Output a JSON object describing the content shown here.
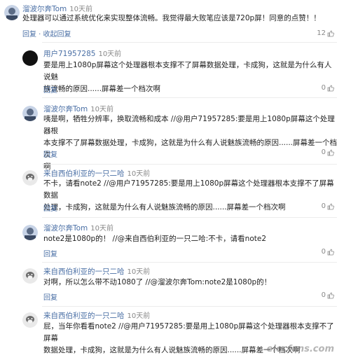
{
  "top": {
    "name": "溜波尔奔Tom",
    "time": "10天前",
    "text": "处理器可以通过系统优化来实现整体流畅。我觉得最大败笔应该是720p屏！同意的点赞！！",
    "reply": "回复",
    "collapse": "收起回复",
    "likes": "12"
  },
  "replies": [
    {
      "name": "用户71957285",
      "time": "10天前",
      "lines": [
        "要是用上1080p屏幕这个处理器根本支撑不了屏幕数据处理，卡成狗，这就是为什么有人说魅",
        "族流畅的原因......屏幕差一个档次啊"
      ],
      "reply": "回复",
      "likes": "0"
    },
    {
      "name": "溜波尔奔Tom",
      "time": "10天前",
      "lines": [
        "咦是啊，牺牲分辨率，换取流畅和成本 //@用户71957285:要是用上1080p屏幕这个处理器根",
        "本支撑不了屏幕数据处理，卡成狗，这就是为什么有人说魅族流畅的原因......屏幕差一个档次",
        "啊"
      ],
      "reply": "回复",
      "likes": "0"
    },
    {
      "name": "来自西伯利亚的一只二哈",
      "time": "10天前",
      "lines": [
        "不卡，请看note2 //@用户71957285:要是用上1080p屏幕这个处理器根本支撑不了屏幕数据",
        "处理，卡成狗，这就是为什么有人说魅族流畅的原因......屏幕差一个档次啊"
      ],
      "reply": "回复",
      "likes": "0"
    },
    {
      "name": "溜波尔奔Tom",
      "time": "10天前",
      "lines": [
        "note2是1080p的！ //@来自西伯利亚的一只二哈:不卡，请看note2"
      ],
      "reply": "回复",
      "likes": "0"
    },
    {
      "name": "来自西伯利亚的一只二哈",
      "time": "10天前",
      "lines": [
        "对啊，所以怎么带不动1080了 //@溜波尔奔Tom:note2是1080p的！"
      ],
      "reply": "回复",
      "likes": "0"
    },
    {
      "name": "来自西伯利亚的一只二哈",
      "time": "10天前",
      "lines": [
        "屁，当年你看看note2 //@用户71957285:要是用上1080p屏幕这个处理器根本支撑不了屏幕",
        "数据处理，卡成狗，这就是为什么有人说魅族流畅的原因......屏幕差一个档次啊"
      ],
      "reply": "回复",
      "likes": "0"
    }
  ],
  "watermark": "elecfans.com",
  "colors": {
    "link": "#4a6fa5",
    "meta": "#888888"
  },
  "icons": {
    "like": "thumbs-up-icon"
  }
}
